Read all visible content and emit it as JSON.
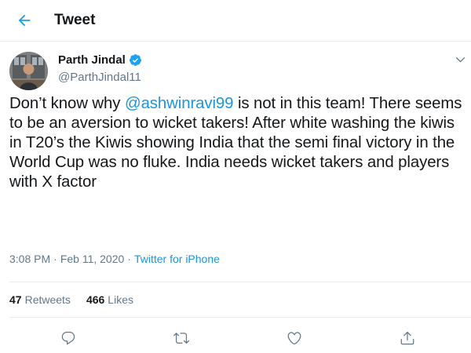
{
  "header": {
    "title": "Tweet"
  },
  "author": {
    "name": "Parth Jindal",
    "handle": "@ParthJindal11"
  },
  "tweet": {
    "text_before": "Don’t know why ",
    "mention": "@ashwinravi99",
    "text_after": " is not in this team! There seems to be an aversion to wicket takers! After white washing the kiwis in T20’s the Kiwis showing India that the semi final victory in the World Cup was no fluke. India needs wicket takers and players with X factor"
  },
  "meta": {
    "time": "3:08 PM",
    "separator": "·",
    "date": "Feb 11, 2020",
    "source": "Twitter for iPhone"
  },
  "stats": {
    "retweets_count": "47",
    "retweets_label": "Retweets",
    "likes_count": "466",
    "likes_label": "Likes"
  },
  "colors": {
    "accent": "#1da1f2",
    "link": "#1b95e0",
    "muted": "#657786",
    "text": "#14171a",
    "border": "#e6ecf0"
  },
  "icons": {
    "back": "arrow-left-icon",
    "verified": "verified-badge-icon",
    "caret": "chevron-down-icon",
    "reply": "reply-icon",
    "retweet": "retweet-icon",
    "like": "heart-icon",
    "share": "share-icon"
  }
}
